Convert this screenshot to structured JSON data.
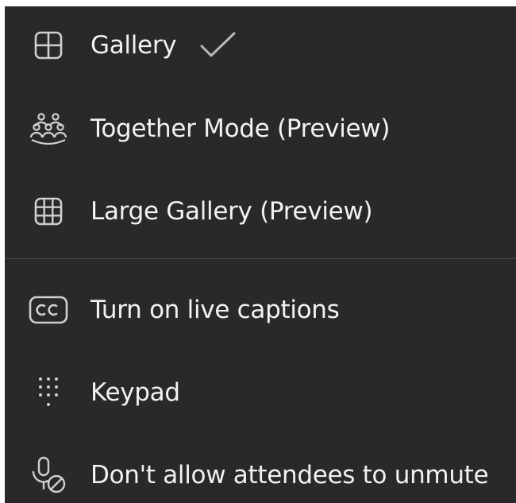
{
  "menu": {
    "items": [
      {
        "label": "Gallery",
        "icon": "gallery-grid-icon",
        "checked": true
      },
      {
        "label": "Together Mode (Preview)",
        "icon": "together-mode-icon"
      },
      {
        "label": "Large Gallery (Preview)",
        "icon": "large-gallery-icon"
      },
      {
        "label": "Turn on live captions",
        "icon": "captions-cc-icon"
      },
      {
        "label": "Keypad",
        "icon": "keypad-icon"
      },
      {
        "label": "Don't allow attendees to unmute",
        "icon": "mic-blocked-icon"
      }
    ]
  },
  "colors": {
    "menu_background": "#292929",
    "text": "#f2f2f2",
    "icon": "#cfcfcf",
    "divider": "#454545"
  }
}
